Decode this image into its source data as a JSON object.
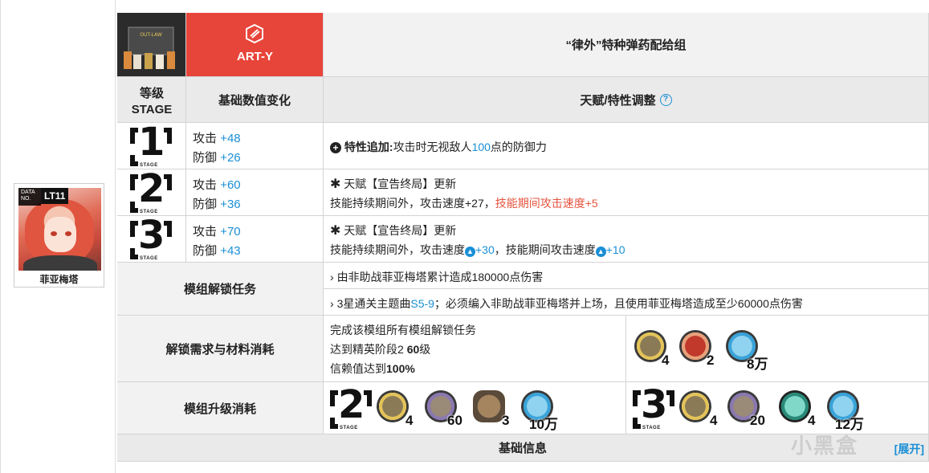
{
  "character": {
    "data_label": "DATA NO.",
    "tag": "LT11",
    "name": "菲亚梅塔"
  },
  "module": {
    "type_code": "ART-Y",
    "module_art_text": "OUT-LAW",
    "name": "“律外”特种弹药配给组",
    "accent_color": "#e8453a"
  },
  "headers": {
    "stage_label": "等级",
    "stage_sub": "STAGE",
    "base_stats": "基础数值变化",
    "talent": "天赋/特性调整",
    "help_icon": "question-circle-icon"
  },
  "stages": [
    {
      "num": "1",
      "stage_word": "STAGE",
      "atk_label": "攻击",
      "atk_val": "+48",
      "def_label": "防御",
      "def_val": "+26",
      "icon": "plus-circle-icon",
      "line1_prefix": "特性追加:",
      "line1_a": "攻击时无视敌人",
      "line1_b": "100",
      "line1_c": "点的防御力"
    },
    {
      "num": "2",
      "stage_word": "STAGE",
      "atk_label": "攻击",
      "atk_val": "+60",
      "def_label": "防御",
      "def_val": "+36",
      "icon": "asterisk-icon",
      "line1": "天赋【宣告终局】更新",
      "line2_a": "技能持续期间外，攻击速度+27，",
      "line2_b": "技能期间攻击速度+5"
    },
    {
      "num": "3",
      "stage_word": "STAGE",
      "atk_label": "攻击",
      "atk_val": "+70",
      "def_label": "防御",
      "def_val": "+43",
      "icon": "asterisk-icon",
      "line1": "天赋【宣告终局】更新",
      "line2_a": "技能持续期间外，攻击速度",
      "line2_b": "+30",
      "line2_c": "，技能期间攻击速度",
      "line2_d": "+10"
    }
  ],
  "unlock_tasks": {
    "label": "模组解锁任务",
    "task1": "由非助战菲亚梅塔累计造成180000点伤害",
    "task2_a": "3星通关主题曲",
    "task2_link": "S5-9",
    "task2_b": "；必须编入非助战菲亚梅塔并上场，且使用菲亚梅塔造成至少60000点伤害"
  },
  "unlock_reqs": {
    "label": "解锁需求与材料消耗",
    "req1": "完成该模组所有模组解锁任务",
    "req2_a": "达到精英阶段2 ",
    "req2_b": "60",
    "req2_c": "级",
    "req3_a": "信赖值达到",
    "req3_b": "100%",
    "materials": [
      {
        "icon": "module-data-block-icon",
        "count": "4"
      },
      {
        "icon": "crystalline-circuit-icon",
        "count": "2"
      },
      {
        "icon": "lmd-icon",
        "count": "8万"
      }
    ]
  },
  "upgrade": {
    "label": "模组升级消耗",
    "stage2": {
      "num": "2",
      "stage_word": "STAGE",
      "materials": [
        {
          "icon": "module-data-block-icon",
          "count": "4"
        },
        {
          "icon": "data-supplement-stick-icon",
          "count": "60"
        },
        {
          "icon": "optimized-device-icon",
          "count": "3"
        },
        {
          "icon": "lmd-icon",
          "count": "10万"
        }
      ]
    },
    "stage3": {
      "num": "3",
      "stage_word": "STAGE",
      "materials": [
        {
          "icon": "module-data-block-icon",
          "count": "4"
        },
        {
          "icon": "data-supplement-instrument-icon",
          "count": "20"
        },
        {
          "icon": "cutting-stock-solution-icon",
          "count": "4"
        },
        {
          "icon": "lmd-icon",
          "count": "12万"
        }
      ]
    }
  },
  "footer": {
    "label": "基础信息",
    "expand": "[展开]"
  },
  "watermark": "小黑盒"
}
